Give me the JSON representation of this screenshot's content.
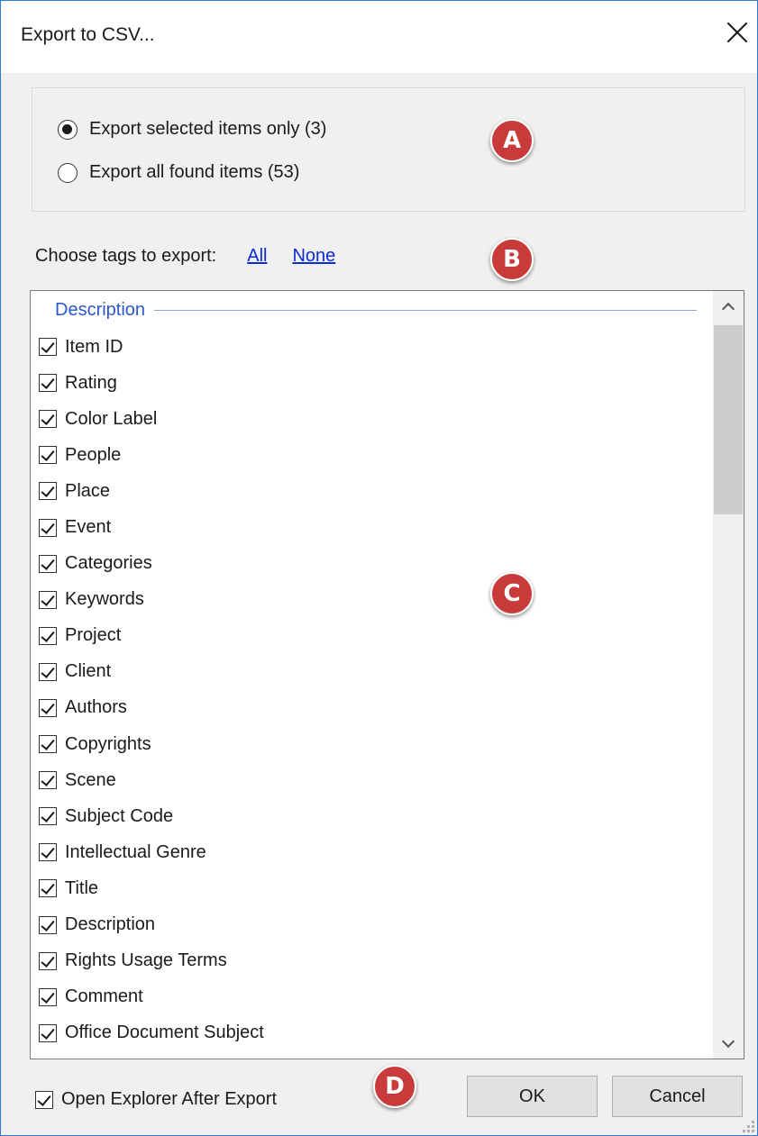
{
  "window": {
    "title": "Export to CSV..."
  },
  "scope": {
    "options": [
      {
        "label": "Export selected items only (3)",
        "checked": true
      },
      {
        "label": "Export all found items (53)",
        "checked": false
      }
    ]
  },
  "tags": {
    "prompt": "Choose tags to export:",
    "all_link": "All",
    "none_link": "None",
    "group_label": "Description",
    "items": [
      {
        "label": "Item ID",
        "checked": true
      },
      {
        "label": "Rating",
        "checked": true
      },
      {
        "label": "Color Label",
        "checked": true
      },
      {
        "label": "People",
        "checked": true
      },
      {
        "label": "Place",
        "checked": true
      },
      {
        "label": "Event",
        "checked": true
      },
      {
        "label": "Categories",
        "checked": true
      },
      {
        "label": "Keywords",
        "checked": true
      },
      {
        "label": "Project",
        "checked": true
      },
      {
        "label": "Client",
        "checked": true
      },
      {
        "label": "Authors",
        "checked": true
      },
      {
        "label": "Copyrights",
        "checked": true
      },
      {
        "label": "Scene",
        "checked": true
      },
      {
        "label": "Subject Code",
        "checked": true
      },
      {
        "label": "Intellectual Genre",
        "checked": true
      },
      {
        "label": "Title",
        "checked": true
      },
      {
        "label": "Description",
        "checked": true
      },
      {
        "label": "Rights Usage Terms",
        "checked": true
      },
      {
        "label": "Comment",
        "checked": true
      },
      {
        "label": "Office Document Subject",
        "checked": true
      }
    ]
  },
  "footer": {
    "open_explorer_label": "Open Explorer After Export",
    "open_explorer_checked": true,
    "ok_label": "OK",
    "cancel_label": "Cancel"
  },
  "callouts": {
    "a": "A",
    "b": "B",
    "c": "C",
    "d": "D"
  },
  "colors": {
    "link": "#0b2bd6",
    "group_header": "#2d57c9",
    "callout": "#c93a3a",
    "window_border": "#2e7bd6"
  }
}
